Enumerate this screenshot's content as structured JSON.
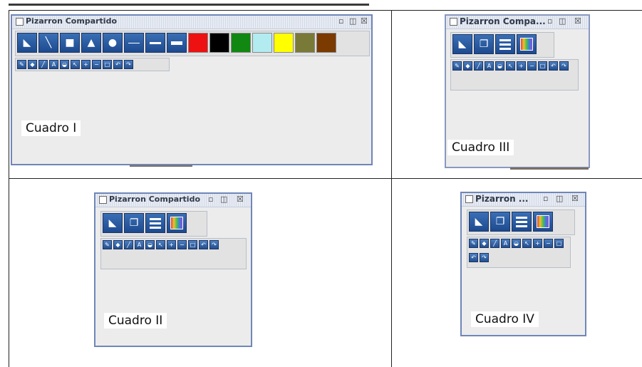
{
  "windows": {
    "w1": {
      "title": "Pizarron Compartido",
      "label": "Cuadro I"
    },
    "w2": {
      "title": "Pizarron Compartido",
      "label": "Cuadro II"
    },
    "w3": {
      "title": "Pizarron Compa...",
      "label": "Cuadro III"
    },
    "w4": {
      "title": "Pizarron ...",
      "label": "Cuadro IV"
    }
  },
  "title_controls": {
    "minimize": "▫",
    "maximize": "◫",
    "close": "☒"
  },
  "shape_tools": [
    "freehand-icon",
    "line-icon",
    "square-icon",
    "triangle-icon",
    "circle-icon",
    "thin-stroke-icon",
    "medium-stroke-icon",
    "thick-stroke-icon"
  ],
  "palette_colors": [
    "#ee1111",
    "#000000",
    "#118811",
    "#b2ecf0",
    "#ffff00",
    "#7a7a38",
    "#7a3a00"
  ],
  "grouped_tools": [
    "draw-tools-icon",
    "shapes-icon",
    "stroke-width-icon",
    "colors-icon"
  ],
  "small_tools": [
    "pencil-icon",
    "eraser-icon",
    "marker-icon",
    "text-icon",
    "fill-icon",
    "select-icon",
    "zoom-in-icon",
    "zoom-out-icon",
    "clear-icon",
    "undo-icon",
    "redo-icon"
  ]
}
